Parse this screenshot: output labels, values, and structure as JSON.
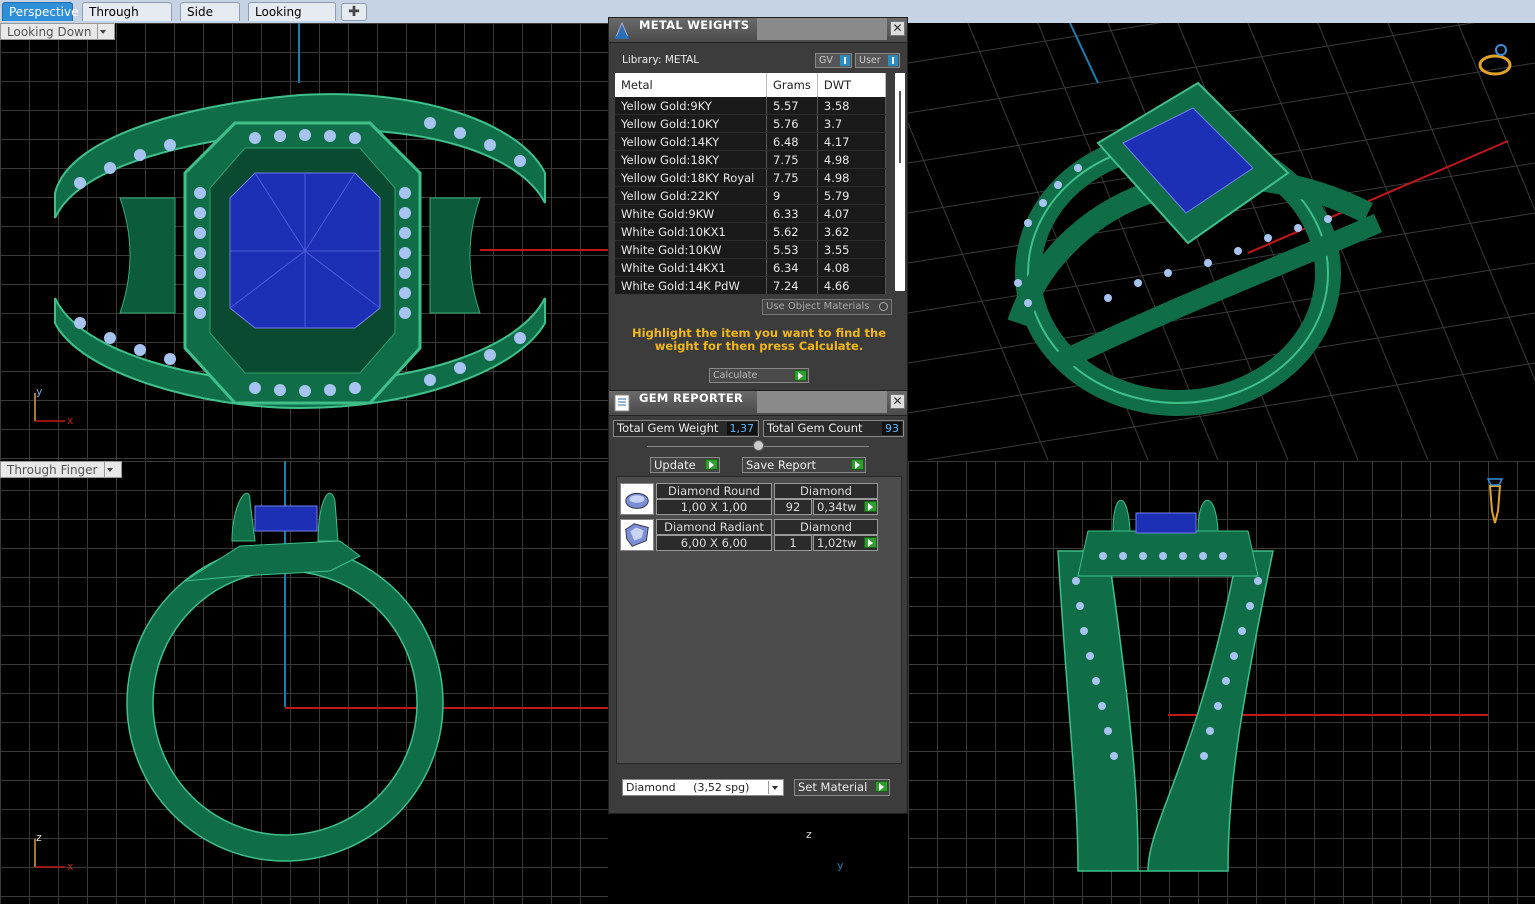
{
  "tabs": [
    {
      "label": "Perspective",
      "active": true
    },
    {
      "label": "Through Finger",
      "active": false
    },
    {
      "label": "Side View",
      "active": false
    },
    {
      "label": "Looking Down",
      "active": false
    }
  ],
  "viewports": {
    "top_left": {
      "label": "Looking Down",
      "axis_v": "y",
      "axis_h": "x"
    },
    "bottom_left": {
      "label": "Through Finger",
      "axis_v": "z",
      "axis_h": "x"
    },
    "bottom_right": {
      "axis_v": "z",
      "axis_h": "y"
    }
  },
  "metal_weights": {
    "title": "METAL WEIGHTS",
    "library": "Library: METAL",
    "gv_label": "GV",
    "user_label": "User",
    "columns": [
      "Metal",
      "Grams",
      "DWT"
    ],
    "rows": [
      [
        "Yellow Gold:9KY",
        "5.57",
        "3.58"
      ],
      [
        "Yellow Gold:10KY",
        "5.76",
        "3.7"
      ],
      [
        "Yellow Gold:14KY",
        "6.48",
        "4.17"
      ],
      [
        "Yellow Gold:18KY",
        "7.75",
        "4.98"
      ],
      [
        "Yellow Gold:18KY Royal",
        "7.75",
        "4.98"
      ],
      [
        "Yellow Gold:22KY",
        "9",
        "5.79"
      ],
      [
        "White Gold:9KW",
        "6.33",
        "4.07"
      ],
      [
        "White Gold:10KX1",
        "5.62",
        "3.62"
      ],
      [
        "White Gold:10KW",
        "5.53",
        "3.55"
      ],
      [
        "White Gold:14KX1",
        "6.34",
        "4.08"
      ],
      [
        "White Gold:14K PdW",
        "7.24",
        "4.66"
      ]
    ],
    "use_object_materials": "Use Object Materials",
    "hint": "Highlight the item you want to find the weight for then press Calculate.",
    "calculate": "Calculate"
  },
  "gem_reporter": {
    "title": "GEM REPORTER",
    "total_weight_label": "Total Gem Weight",
    "total_weight": "1,37",
    "total_count_label": "Total Gem Count",
    "total_count": "93",
    "update": "Update",
    "save_report": "Save Report",
    "gems": [
      {
        "shape": "Diamond Round",
        "material": "Diamond",
        "size": "1,00 X 1,00",
        "count": "92",
        "weight": "0,34tw"
      },
      {
        "shape": "Diamond Radiant",
        "material": "Diamond",
        "size": "6,00 X 6,00",
        "count": "1",
        "weight": "1,02tw"
      }
    ],
    "material_select": "Diamond     (3,52 spg)",
    "set_material": "Set Material"
  },
  "colors": {
    "ring_green": "#0f6e48",
    "gem_blue": "#1d2fb5",
    "melee": "#a7c4f0",
    "hint_orange": "#f2b71b"
  }
}
